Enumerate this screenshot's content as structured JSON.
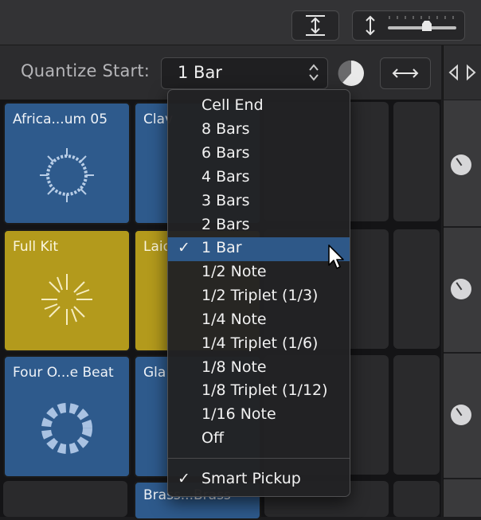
{
  "toolbar": {
    "quantize_label": "Quantize Start:",
    "quantize_value": "1 Bar"
  },
  "cells": {
    "c1": "Africa...um 05",
    "c2": "Clav",
    "c3": "Full Kit",
    "c4": "Laid",
    "c5": "Four O...e Beat",
    "c6": "Gla",
    "c7": "Brass...Brass"
  },
  "menu": {
    "items": [
      {
        "label": "Cell End",
        "checked": false
      },
      {
        "label": "8 Bars",
        "checked": false
      },
      {
        "label": "6 Bars",
        "checked": false
      },
      {
        "label": "4 Bars",
        "checked": false
      },
      {
        "label": "3 Bars",
        "checked": false
      },
      {
        "label": "2 Bars",
        "checked": false
      },
      {
        "label": "1 Bar",
        "checked": true
      },
      {
        "label": "1/2 Note",
        "checked": false
      },
      {
        "label": "1/2 Triplet (1/3)",
        "checked": false
      },
      {
        "label": "1/4 Note",
        "checked": false
      },
      {
        "label": "1/4 Triplet (1/6)",
        "checked": false
      },
      {
        "label": "1/8 Note",
        "checked": false
      },
      {
        "label": "1/8 Triplet (1/12)",
        "checked": false
      },
      {
        "label": "1/16 Note",
        "checked": false
      },
      {
        "label": "Off",
        "checked": false
      }
    ],
    "smart_pickup": {
      "label": "Smart Pickup",
      "checked": true
    },
    "check_glyph": "✓"
  },
  "colors": {
    "blue_cell": "#2e5a8c",
    "gold_cell": "#b39a1c",
    "highlight": "#2e5888"
  },
  "icons": {
    "fit": "vertical-fit-icon",
    "zoom": "vertical-resize-icon",
    "quant_arrows": "up-down-chevron-icon",
    "pie": "play-from-pie-icon",
    "horizontal": "horizontal-resize-icon",
    "panel": "left-right-triangles-icon"
  }
}
